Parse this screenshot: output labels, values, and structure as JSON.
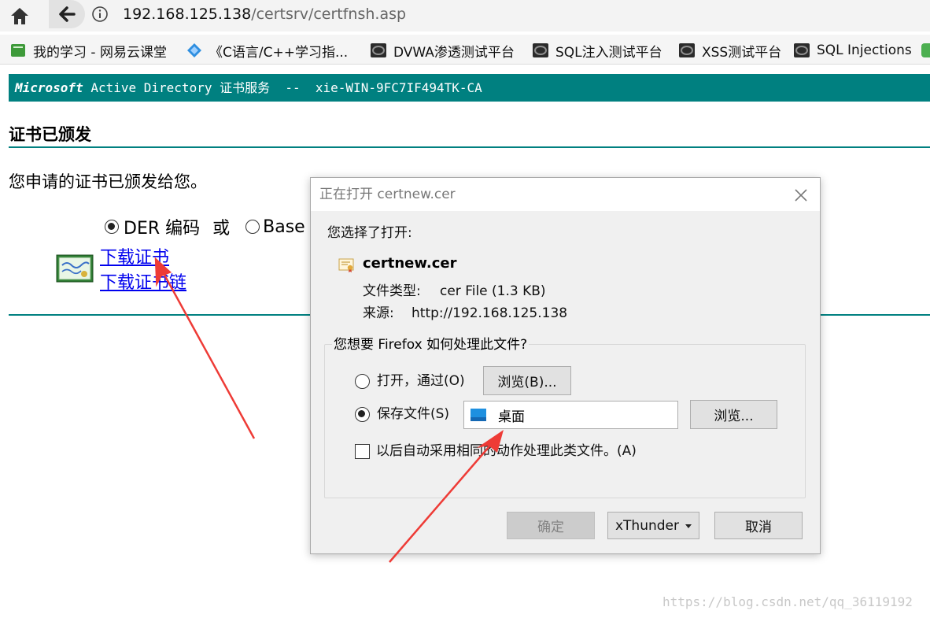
{
  "browser": {
    "url_host": "192.168.125.138",
    "url_path": "/certsrv/certfnsh.asp",
    "bookmarks": [
      {
        "label": "我的学习 - 网易云课堂",
        "icon": "book-icon"
      },
      {
        "label": "《C语言/C++学习指...",
        "icon": "diamond-icon"
      },
      {
        "label": "DVWA渗透测试平台",
        "icon": "site-icon"
      },
      {
        "label": "SQL注入测试平台",
        "icon": "site-icon"
      },
      {
        "label": "XSS测试平台",
        "icon": "site-icon"
      },
      {
        "label": "SQL Injections",
        "icon": "site-icon"
      }
    ]
  },
  "page": {
    "banner_brand": "Microsoft",
    "banner_rest": " Active Directory 证书服务  --  xie-WIN-9FC7IF494TK-CA",
    "heading": "证书已颁发",
    "issued_text": "您申请的证书已颁发给您。",
    "encoding_der": "DER 编码",
    "encoding_or": "或",
    "encoding_base": "Base",
    "link_download_cert": "下载证书",
    "link_download_chain": "下载证书链"
  },
  "dialog": {
    "title": "正在打开 certnew.cer",
    "chose_label": "您选择了打开:",
    "file_name": "certnew.cer",
    "file_type_label": "文件类型:",
    "file_type_value": "cer File (1.3 KB)",
    "source_label": "来源:",
    "source_value": "http://192.168.125.138",
    "group_title": "您想要 Firefox 如何处理此文件?",
    "open_with_label": "打开，通过(O)",
    "browse_open_button": "浏览(B)...",
    "save_file_label": "保存文件(S)",
    "save_location": "桌面",
    "browse_save_button": "浏览...",
    "auto_label": "以后自动采用相同的动作处理此类文件。(A)",
    "ok_button": "确定",
    "xthunder_button": "xThunder",
    "cancel_button": "取消"
  },
  "watermark": "https://blog.csdn.net/qq_36119192",
  "colors": {
    "teal": "#008080",
    "arrow": "#ee3b36",
    "link": "#0000ee"
  }
}
